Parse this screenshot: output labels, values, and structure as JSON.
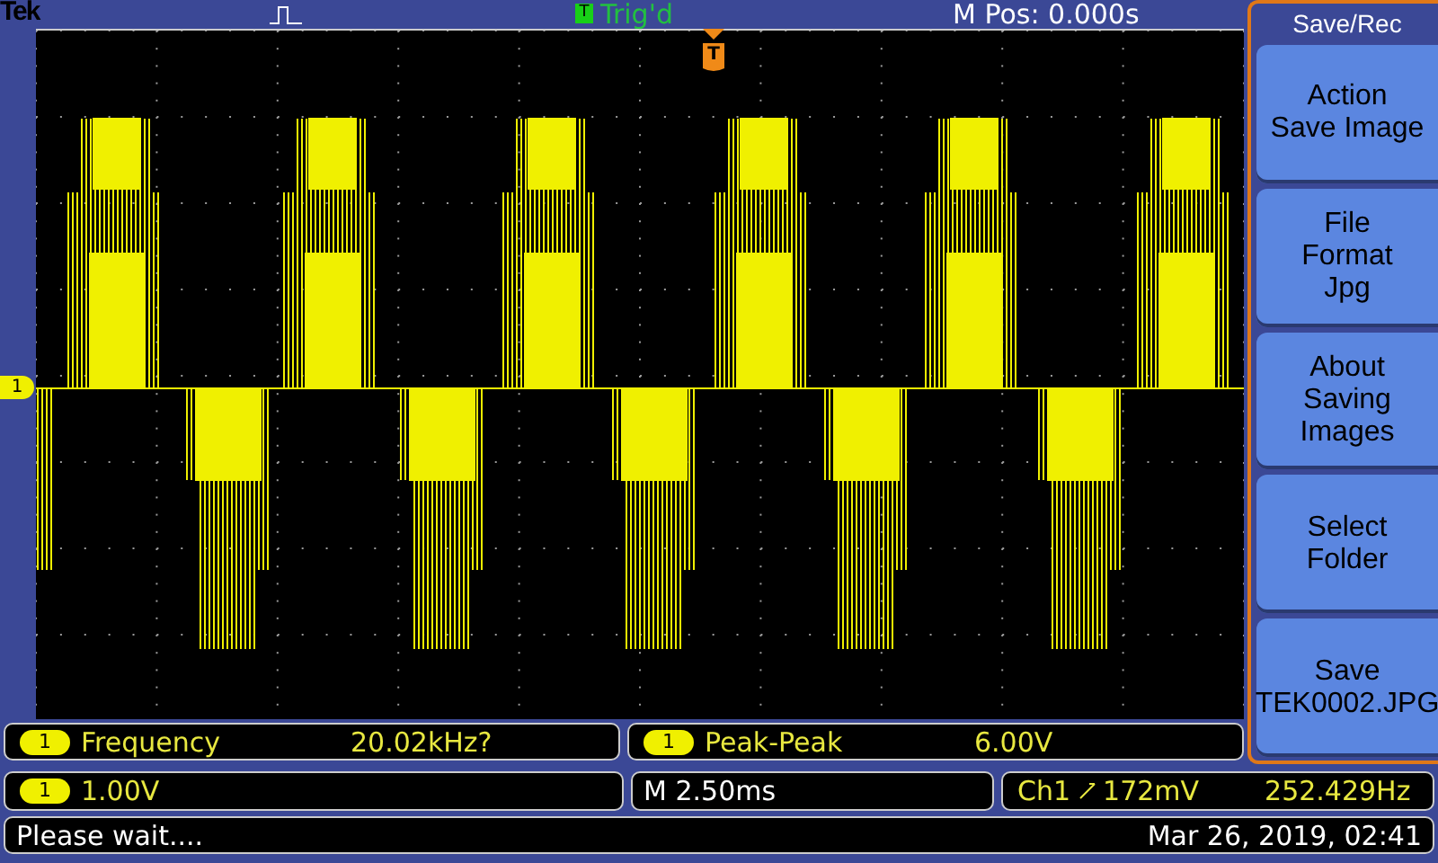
{
  "top_bar": {
    "brand": "Tek",
    "trigger_badge": "T",
    "trigger_status": "Trig'd",
    "position": "M Pos: 0.000s"
  },
  "display": {
    "channel_marker": "1",
    "trigger_marker": "T"
  },
  "menu": {
    "title": "Save/Rec",
    "buttons": [
      {
        "lines": [
          "Action",
          "Save Image"
        ]
      },
      {
        "lines": [
          "File",
          "Format",
          "Jpg"
        ]
      },
      {
        "lines": [
          "About",
          "Saving",
          "Images"
        ]
      },
      {
        "lines": [
          "Select",
          "Folder"
        ]
      },
      {
        "lines": [
          "Save",
          "TEK0002.JPG"
        ]
      }
    ]
  },
  "measurements": [
    {
      "channel": "1",
      "name": "Frequency",
      "value": "20.02kHz?"
    },
    {
      "channel": "1",
      "name": "Peak-Peak",
      "value": "6.00V"
    }
  ],
  "settings": {
    "channel": "1",
    "scale": "1.00V",
    "timebase": "M 2.50ms",
    "trigger_source": "Ch1",
    "trigger_level": "172mV",
    "trigger_frequency": "252.429Hz"
  },
  "status_bar": {
    "message": "Please wait....",
    "datetime": "Mar 26, 2019, 02:41"
  }
}
